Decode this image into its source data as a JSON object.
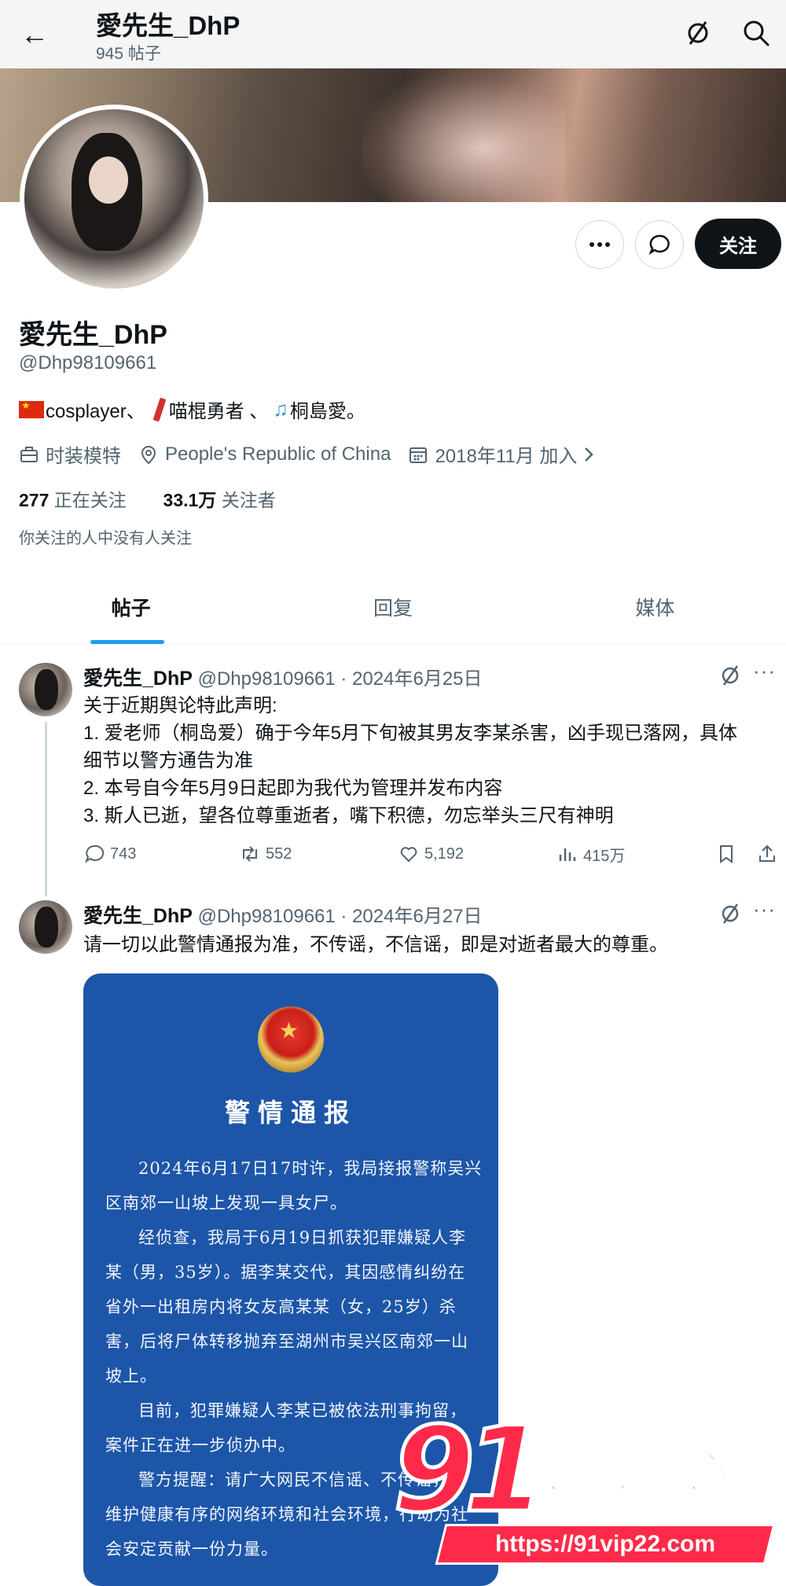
{
  "header": {
    "back_label": "←",
    "title": "愛先生_DhP",
    "post_count": "945 帖子"
  },
  "profile": {
    "name": "愛先生_DhP",
    "handle": "@Dhp98109661",
    "bio": {
      "part1": "cosplayer、",
      "part2": "喵棍勇者 、",
      "part3": "桐島愛。"
    },
    "category": "时装模特",
    "location": "People's Republic of China",
    "joined": "2018年11月 加入",
    "following_count": "277",
    "following_label": "正在关注",
    "followers_count": "33.1万",
    "followers_label": "关注者",
    "mutual_note": "你关注的人中没有人关注",
    "follow_button": "关注"
  },
  "tabs": [
    {
      "label": "帖子",
      "active": true
    },
    {
      "label": "回复",
      "active": false
    },
    {
      "label": "媒体",
      "active": false
    }
  ],
  "tweets": [
    {
      "name": "愛先生_DhP",
      "meta": "@Dhp98109661 · 2024年6月25日",
      "lines": [
        "关于近期舆论特此声明:",
        "1. 爱老师（桐岛爱）确于今年5月下旬被其男友李某杀害，凶手现已落网，具体",
        "细节以警方通告为准",
        "2. 本号自今年5月9日起即为我代为管理并发布内容",
        "3. 斯人已逝，望各位尊重逝者，嘴下积德，勿忘举头三尺有神明"
      ],
      "replies": "743",
      "retweets": "552",
      "likes": "5,192",
      "views": "415万"
    },
    {
      "name": "愛先生_DhP",
      "meta": "@Dhp98109661 · 2024年6月27日",
      "text": "请一切以此警情通报为准，不传谣，不信谣，即是对逝者最大的尊重。"
    }
  ],
  "notice": {
    "title": "警情通报",
    "p1": "2024年6月17日17时许，我局接报警称吴兴区南郊一山坡上发现一具女尸。",
    "p2": "经侦查，我局于6月19日抓获犯罪嫌疑人李某（男，35岁）。据李某交代，其因感情纠纷在省外一出租房内将女友高某某（女，25岁）杀害，后将尸体转移抛弃至湖州市吴兴区南郊一山坡上。",
    "p3": "目前，犯罪嫌疑人李某已被依法刑事拘留，案件正在进一步侦办中。",
    "p4": "警方提醒：请广大网民不信谣、不传谣，同维护健康有序的网络环境和社会环境，行动为社会安定贡献一份力量。"
  },
  "watermark": {
    "number": "91",
    "slogan": "吃瓜中心",
    "url": "https://91vip22.com"
  },
  "colors": {
    "accent": "#1d9bf0",
    "notice_bg": "#1d56a8",
    "watermark": "#ff2a4a"
  }
}
